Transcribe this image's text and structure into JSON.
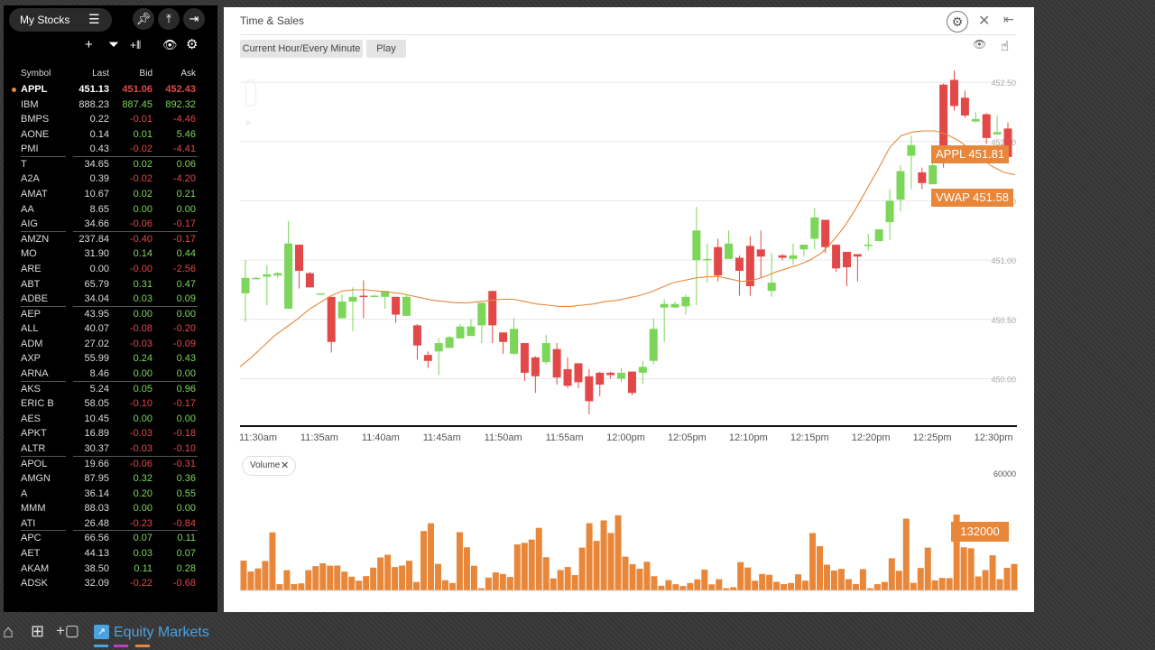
{
  "watchlist": {
    "title": "My Stocks",
    "columns": {
      "symbol": "Symbol",
      "last": "Last",
      "bid": "Bid",
      "ask": "Ask"
    },
    "rows": [
      {
        "symbol": "APPL",
        "last": "451.13",
        "bid": "451.06",
        "ask": "452.43",
        "bidc": "neg",
        "askc": "neg",
        "selected": true
      },
      {
        "symbol": "IBM",
        "last": "888.23",
        "bid": "887.45",
        "ask": "892.32",
        "bidc": "pos",
        "askc": "pos"
      },
      {
        "symbol": "BMPS",
        "last": "0.22",
        "bid": "-0.01",
        "ask": "-4.46",
        "bidc": "neg",
        "askc": "neg"
      },
      {
        "symbol": "AONE",
        "last": "0.14",
        "bid": "0.01",
        "ask": "5.46",
        "bidc": "pos",
        "askc": "pos"
      },
      {
        "symbol": "PMI",
        "last": "0.43",
        "bid": "-0.02",
        "ask": "-4.41",
        "bidc": "neg",
        "askc": "neg"
      },
      {
        "symbol": "T",
        "last": "34.65",
        "bid": "0.02",
        "ask": "0.06",
        "bidc": "pos",
        "askc": "pos"
      },
      {
        "symbol": "A2A",
        "last": "0.39",
        "bid": "-0.02",
        "ask": "-4.20",
        "bidc": "neg",
        "askc": "neg"
      },
      {
        "symbol": "AMAT",
        "last": "10.67",
        "bid": "0.02",
        "ask": "0.21",
        "bidc": "pos",
        "askc": "pos"
      },
      {
        "symbol": "AA",
        "last": "8.65",
        "bid": "0.00",
        "ask": "0.00",
        "bidc": "pos",
        "askc": "pos"
      },
      {
        "symbol": "AIG",
        "last": "34.66",
        "bid": "-0.06",
        "ask": "-0.17",
        "bidc": "neg",
        "askc": "neg"
      },
      {
        "symbol": "AMZN",
        "last": "237.84",
        "bid": "-0.40",
        "ask": "-0.17",
        "bidc": "neg",
        "askc": "neg"
      },
      {
        "symbol": "MO",
        "last": "31.90",
        "bid": "0.14",
        "ask": "0.44",
        "bidc": "pos",
        "askc": "pos"
      },
      {
        "symbol": "ARE",
        "last": "0.00",
        "bid": "-0.00",
        "ask": "-2.56",
        "bidc": "neg",
        "askc": "neg"
      },
      {
        "symbol": "ABT",
        "last": "65.79",
        "bid": "0.31",
        "ask": "0.47",
        "bidc": "pos",
        "askc": "pos"
      },
      {
        "symbol": "ADBE",
        "last": "34.04",
        "bid": "0.03",
        "ask": "0.09",
        "bidc": "pos",
        "askc": "pos"
      },
      {
        "symbol": "AEP",
        "last": "43.95",
        "bid": "0.00",
        "ask": "0.00",
        "bidc": "pos",
        "askc": "pos"
      },
      {
        "symbol": "ALL",
        "last": "40.07",
        "bid": "-0.08",
        "ask": "-0.20",
        "bidc": "neg",
        "askc": "neg"
      },
      {
        "symbol": "ADM",
        "last": "27.02",
        "bid": "-0.03",
        "ask": "-0.09",
        "bidc": "neg",
        "askc": "neg"
      },
      {
        "symbol": "AXP",
        "last": "55.99",
        "bid": "0.24",
        "ask": "0.43",
        "bidc": "pos",
        "askc": "pos"
      },
      {
        "symbol": "ARNA",
        "last": "8.46",
        "bid": "0.00",
        "ask": "0.00",
        "bidc": "pos",
        "askc": "pos"
      },
      {
        "symbol": "AKS",
        "last": "5.24",
        "bid": "0.05",
        "ask": "0.96",
        "bidc": "pos",
        "askc": "pos"
      },
      {
        "symbol": "ERIC B",
        "last": "58.05",
        "bid": "-0.10",
        "ask": "-0.17",
        "bidc": "neg",
        "askc": "neg"
      },
      {
        "symbol": "AES",
        "last": "10.45",
        "bid": "0.00",
        "ask": "0.00",
        "bidc": "pos",
        "askc": "pos"
      },
      {
        "symbol": "APKT",
        "last": "16.89",
        "bid": "-0.03",
        "ask": "-0.18",
        "bidc": "neg",
        "askc": "neg"
      },
      {
        "symbol": "ALTR",
        "last": "30.37",
        "bid": "-0.03",
        "ask": "-0.10",
        "bidc": "neg",
        "askc": "neg"
      },
      {
        "symbol": "APOL",
        "last": "19.66",
        "bid": "-0.06",
        "ask": "-0.31",
        "bidc": "neg",
        "askc": "neg"
      },
      {
        "symbol": "AMGN",
        "last": "87.95",
        "bid": "0.32",
        "ask": "0.36",
        "bidc": "pos",
        "askc": "pos"
      },
      {
        "symbol": "A",
        "last": "36.14",
        "bid": "0.20",
        "ask": "0.55",
        "bidc": "pos",
        "askc": "pos"
      },
      {
        "symbol": "MMM",
        "last": "88.03",
        "bid": "0.00",
        "ask": "0.00",
        "bidc": "pos",
        "askc": "pos"
      },
      {
        "symbol": "ATI",
        "last": "26.48",
        "bid": "-0.23",
        "ask": "-0.84",
        "bidc": "neg",
        "askc": "neg"
      },
      {
        "symbol": "APC",
        "last": "66.56",
        "bid": "0.07",
        "ask": "0.11",
        "bidc": "pos",
        "askc": "pos"
      },
      {
        "symbol": "AET",
        "last": "44.13",
        "bid": "0.03",
        "ask": "0.07",
        "bidc": "pos",
        "askc": "pos"
      },
      {
        "symbol": "AKAM",
        "last": "38.50",
        "bid": "0.11",
        "ask": "0.28",
        "bidc": "pos",
        "askc": "pos"
      },
      {
        "symbol": "ADSK",
        "last": "32.09",
        "bid": "-0.22",
        "ask": "-0.68",
        "bidc": "neg",
        "askc": "neg"
      }
    ]
  },
  "window": {
    "title": "Time & Sales",
    "range_button": "Current Hour/Every Minute",
    "play_button": "Play"
  },
  "price_chart": {
    "y_ticks": [
      "452.50",
      "452.00",
      "451.50",
      "451.00",
      "450.50",
      "450.00"
    ],
    "x_ticks": [
      "11:30am",
      "11:35am",
      "11:40am",
      "11:45am",
      "11:50am",
      "11:55am",
      "12:00pm",
      "12:05pm",
      "12:10pm",
      "12:15pm",
      "12:20pm",
      "12:25pm",
      "12:30pm"
    ],
    "last_tag": "APPL 451.81",
    "vwap_tag": "VWAP 451.58"
  },
  "volume_chart": {
    "chip_label": "Volume",
    "max_label": "60000",
    "current_tag": "132000"
  },
  "taskbar": {
    "active_label": "Equity Markets"
  },
  "colors": {
    "up": "#7cd65a",
    "down": "#e34848",
    "accent": "#e8873a",
    "link": "#4aa3df"
  },
  "chart_data": {
    "type": "candlestick",
    "y_unit": "price",
    "x_range": [
      "11:30am",
      "12:33pm"
    ],
    "ylim": [
      449.6,
      452.6
    ],
    "candles": [
      [
        450.72,
        450.85,
        450.48,
        451.0
      ],
      [
        450.85,
        450.85,
        450.84,
        450.86
      ],
      [
        450.86,
        450.88,
        450.62,
        450.96
      ],
      [
        450.87,
        450.89,
        450.85,
        450.9
      ],
      [
        450.59,
        451.14,
        450.59,
        451.33
      ],
      [
        451.13,
        450.91,
        450.76,
        451.13
      ],
      [
        450.89,
        450.77,
        450.77,
        450.9
      ],
      [
        450.72,
        450.72,
        450.71,
        450.72
      ],
      [
        450.69,
        450.31,
        450.22,
        450.69
      ],
      [
        450.51,
        450.65,
        450.51,
        450.71
      ],
      [
        450.65,
        450.69,
        450.4,
        450.77
      ],
      [
        450.7,
        450.69,
        450.51,
        450.83
      ],
      [
        450.69,
        450.7,
        450.69,
        450.71
      ],
      [
        450.69,
        450.74,
        450.59,
        450.73
      ],
      [
        450.69,
        450.54,
        450.47,
        450.69
      ],
      [
        450.53,
        450.69,
        450.53,
        450.71
      ],
      [
        450.45,
        450.28,
        450.16,
        450.46
      ],
      [
        450.2,
        450.15,
        450.09,
        450.23
      ],
      [
        450.23,
        450.3,
        450.03,
        450.34
      ],
      [
        450.26,
        450.35,
        450.26,
        450.36
      ],
      [
        450.34,
        450.44,
        450.34,
        450.46
      ],
      [
        450.36,
        450.44,
        450.36,
        450.5
      ],
      [
        450.45,
        450.64,
        450.3,
        450.63
      ],
      [
        450.74,
        450.45,
        450.3,
        450.74
      ],
      [
        450.39,
        450.31,
        450.21,
        450.39
      ],
      [
        450.21,
        450.42,
        450.2,
        450.51
      ],
      [
        450.3,
        450.05,
        449.98,
        450.3
      ],
      [
        450.18,
        450.02,
        449.88,
        450.19
      ],
      [
        450.14,
        450.3,
        450.12,
        450.37
      ],
      [
        450.25,
        450.01,
        449.95,
        450.3
      ],
      [
        450.08,
        449.94,
        449.92,
        450.18
      ],
      [
        450.13,
        449.97,
        449.92,
        450.0
      ],
      [
        450.02,
        449.81,
        449.7,
        450.08
      ],
      [
        450.05,
        449.95,
        449.85,
        450.06
      ],
      [
        450.05,
        450.03,
        450.0,
        450.06
      ],
      [
        450.0,
        450.05,
        449.97,
        450.09
      ],
      [
        450.06,
        449.88,
        449.86,
        450.06
      ],
      [
        450.05,
        450.1,
        449.96,
        450.15
      ],
      [
        450.15,
        450.42,
        450.12,
        450.51
      ],
      [
        450.6,
        450.63,
        450.31,
        450.67
      ],
      [
        450.6,
        450.63,
        450.63,
        450.65
      ],
      [
        450.61,
        450.69,
        450.54,
        450.71
      ],
      [
        451.0,
        451.25,
        450.62,
        451.45
      ],
      [
        451.0,
        451.01,
        450.81,
        451.14
      ],
      [
        451.11,
        450.87,
        450.82,
        451.18
      ],
      [
        451.01,
        451.14,
        451.01,
        451.25
      ],
      [
        451.02,
        450.91,
        450.7,
        451.04
      ],
      [
        451.12,
        450.78,
        450.7,
        451.2
      ],
      [
        451.09,
        451.03,
        450.85,
        451.25
      ],
      [
        450.74,
        450.81,
        450.69,
        451.06
      ],
      [
        451.04,
        451.02,
        451.0,
        451.05
      ],
      [
        451.01,
        451.04,
        450.96,
        451.14
      ],
      [
        451.09,
        451.13,
        451.03,
        451.13
      ],
      [
        451.18,
        451.36,
        451.09,
        451.44
      ],
      [
        451.34,
        451.11,
        451.06,
        451.34
      ],
      [
        451.13,
        450.93,
        450.9,
        451.1
      ],
      [
        451.07,
        450.94,
        450.78,
        451.06
      ],
      [
        451.05,
        451.03,
        450.82,
        451.05
      ],
      [
        451.13,
        451.13,
        451.08,
        451.22
      ],
      [
        451.16,
        451.26,
        451.18,
        451.25
      ],
      [
        451.32,
        451.5,
        451.17,
        451.6
      ],
      [
        451.51,
        451.75,
        451.41,
        451.8
      ],
      [
        451.88,
        451.97,
        451.6,
        452.05
      ],
      [
        451.74,
        451.65,
        451.6,
        451.78
      ],
      [
        451.64,
        451.8,
        451.64,
        451.82
      ],
      [
        452.48,
        451.85,
        451.78,
        452.49
      ],
      [
        452.52,
        452.3,
        452.26,
        452.6
      ],
      [
        452.37,
        452.22,
        452.2,
        452.43
      ],
      [
        452.17,
        452.19,
        452.16,
        452.25
      ],
      [
        452.23,
        452.03,
        451.98,
        452.24
      ],
      [
        452.06,
        452.08,
        452.08,
        452.22
      ],
      [
        452.11,
        451.87,
        451.85,
        452.16
      ]
    ],
    "vwap": [
      450.1,
      450.18,
      450.27,
      450.36,
      450.43,
      450.5,
      450.58,
      450.64,
      450.7,
      450.74,
      450.75,
      450.75,
      450.74,
      450.73,
      450.72,
      450.7,
      450.68,
      450.66,
      450.65,
      450.64,
      450.64,
      450.65,
      450.66,
      450.67,
      450.67,
      450.65,
      450.63,
      450.62,
      450.61,
      450.61,
      450.62,
      450.63,
      450.65,
      450.66,
      450.68,
      450.7,
      450.73,
      450.77,
      450.81,
      450.83,
      450.85,
      450.86,
      450.86,
      450.84,
      450.82,
      450.83,
      450.86,
      450.9,
      450.93,
      450.96,
      451.0,
      451.06,
      451.16,
      451.28,
      451.43,
      451.6,
      451.77,
      451.95,
      452.05,
      452.08,
      452.09,
      452.09,
      452.06,
      452.01,
      451.94,
      451.86,
      451.79,
      451.74,
      451.72
    ],
    "volume_ylim": [
      0,
      60000
    ],
    "volume": [
      15360,
      9750,
      11330,
      15160,
      29890,
      3230,
      10430,
      3290,
      3620,
      10460,
      12500,
      13980,
      12740,
      12820,
      9690,
      7100,
      4990,
      7370,
      11750,
      17000,
      18380,
      12050,
      12820,
      15320,
      4350,
      30590,
      34600,
      13670,
      5250,
      3790,
      30010,
      22200,
      12680,
      1140,
      6590,
      9270,
      8470,
      6910,
      23710,
      24520,
      26200,
      32250,
      17100,
      6210,
      10480,
      12070,
      7890,
      22060,
      34630,
      25530,
      36060,
      29600,
      38720,
      17380,
      13520,
      11190,
      14760,
      7320,
      2410,
      5290,
      3200,
      2270,
      3790,
      5700,
      10690,
      3130,
      5770,
      1140,
      1640,
      14580,
      11800,
      4990,
      8470,
      8030,
      4410,
      3260,
      3850,
      8300,
      5020,
      29560,
      22820,
      13260,
      10240,
      11110,
      5800,
      3320,
      10980,
      1110,
      3220,
      4360,
      16560,
      10100,
      36980,
      3860,
      11550,
      22050,
      5160,
      6450,
      6330,
      39050,
      22200,
      21720,
      7200,
      10500,
      18100,
      5820,
      11640,
      13640
    ]
  }
}
